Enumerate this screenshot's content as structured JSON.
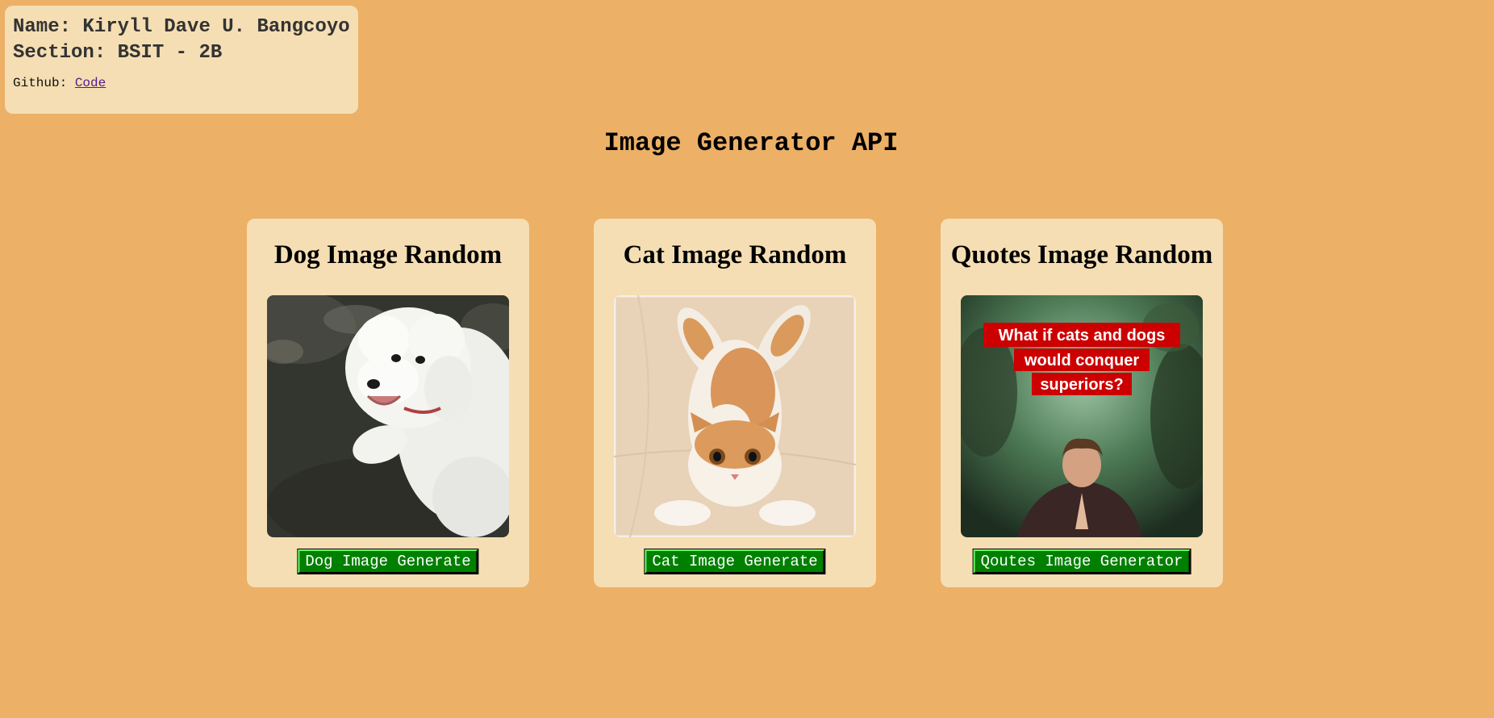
{
  "info": {
    "name_line": "Name: Kiryll Dave U. Bangcoyo",
    "section_line": "Section: BSIT - 2B",
    "github_label": "Github:",
    "github_link": "Code"
  },
  "page": {
    "title": "Image Generator API"
  },
  "cards": {
    "dog": {
      "title": "Dog Image Random",
      "button": "Dog Image Generate"
    },
    "cat": {
      "title": "Cat Image Random",
      "button": "Cat Image Generate"
    },
    "quote": {
      "title": "Quotes Image Random",
      "button": "Qoutes Image Generator",
      "image_text": [
        "What if cats and dogs",
        "would conquer",
        "superiors?"
      ]
    }
  },
  "colors": {
    "background": "#ECB066",
    "card": "#F5DEB3",
    "button": "#008000",
    "link": "#551A8B"
  }
}
